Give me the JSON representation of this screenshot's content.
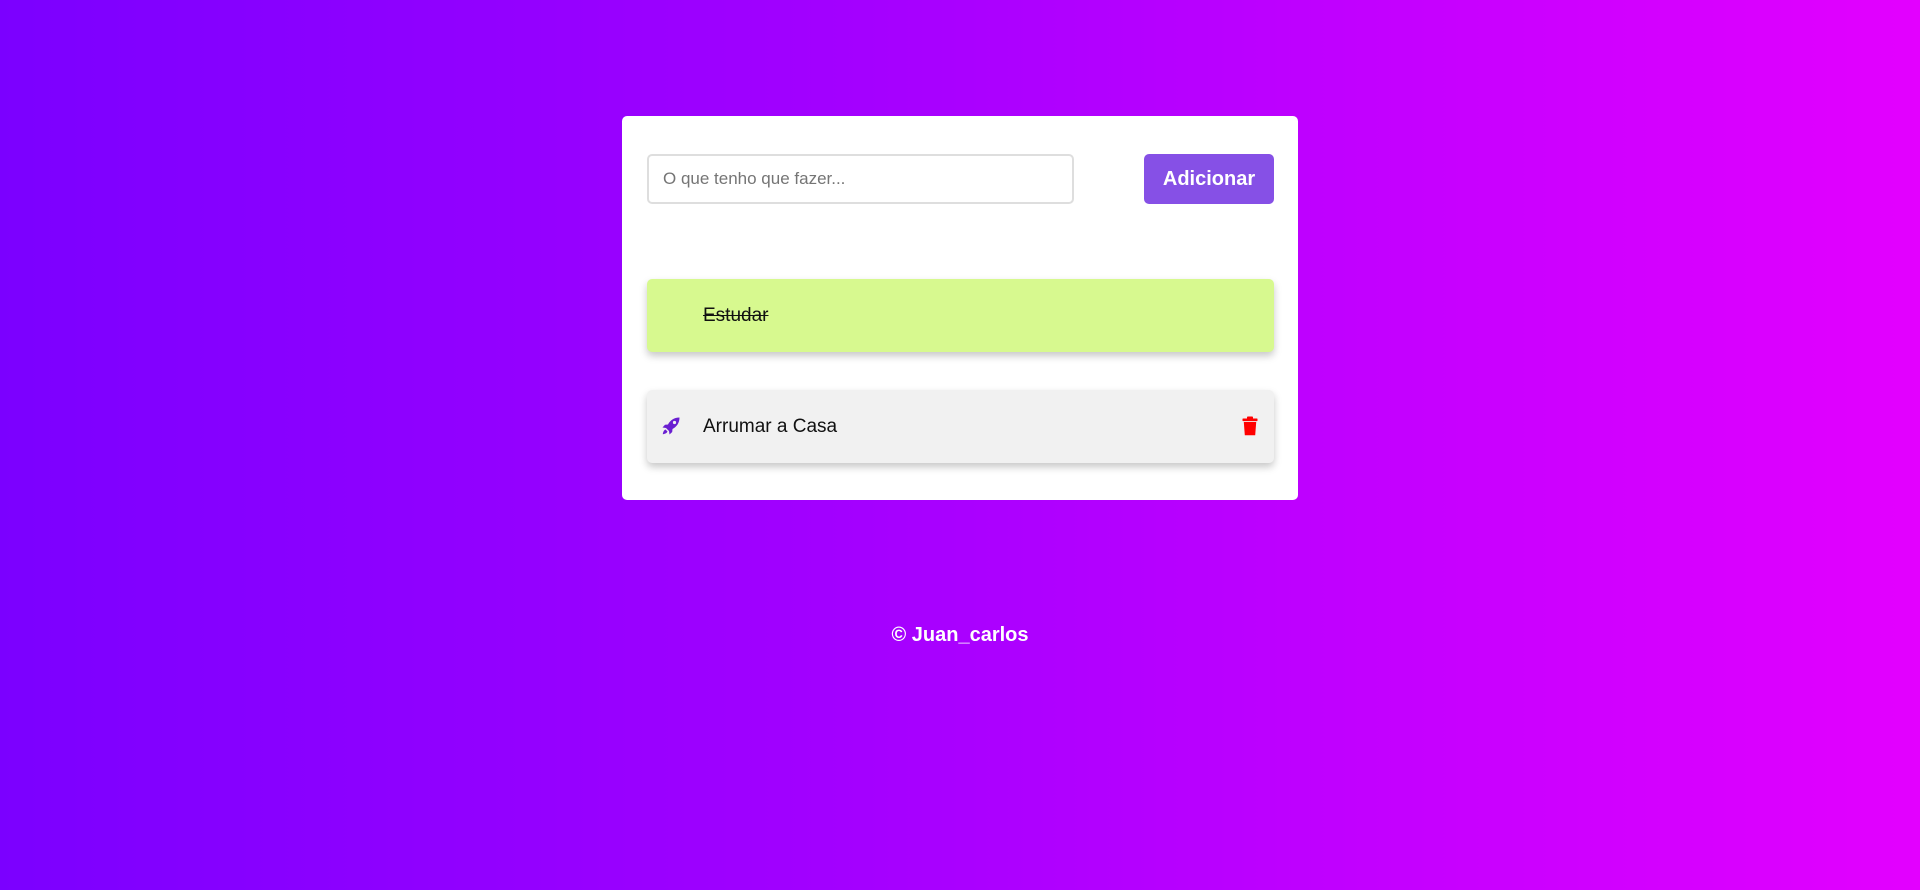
{
  "form": {
    "input_placeholder": "O que tenho que fazer...",
    "input_value": "",
    "add_label": "Adicionar"
  },
  "tasks": [
    {
      "label": "Estudar",
      "completed": true,
      "bg": "#d7f98f"
    },
    {
      "label": "Arrumar a Casa",
      "completed": false,
      "bg": "#f1f1f1",
      "icon": "rocket-icon",
      "delete_icon": "trash-icon"
    }
  ],
  "colors": {
    "accent": "#8650e6",
    "rocket": "#6a1fd1",
    "delete": "#ff0000"
  },
  "footer": {
    "text": "© Juan_carlos"
  }
}
